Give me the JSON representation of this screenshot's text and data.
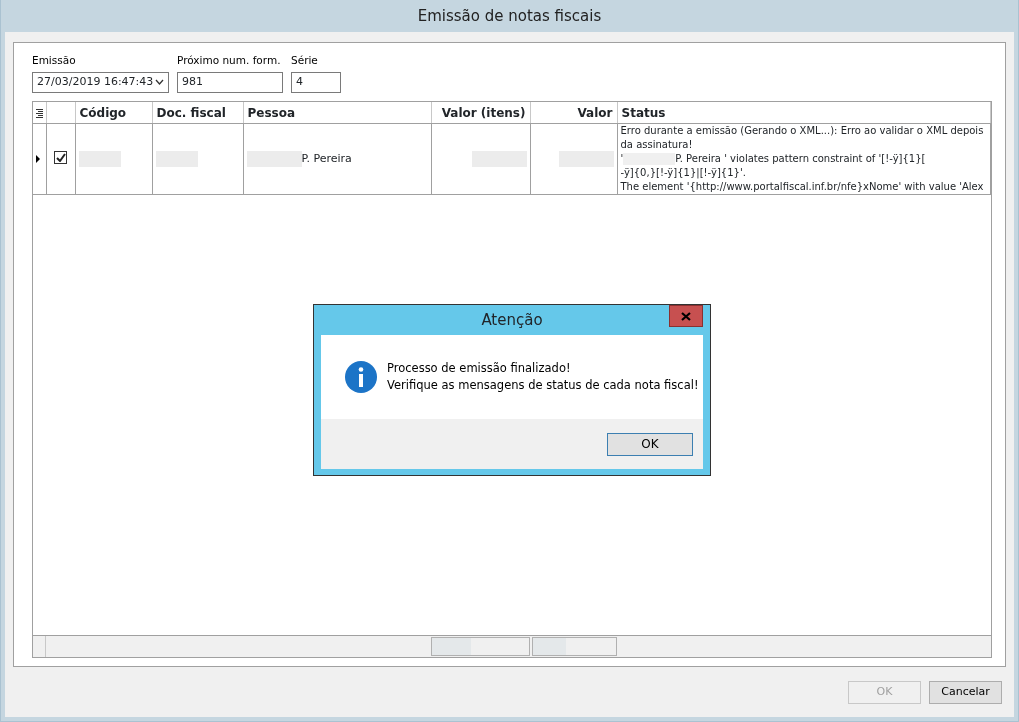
{
  "window": {
    "title": "Emissão de notas fiscais"
  },
  "fields": [
    {
      "label": "Emissão",
      "value": "27/03/2019 16:47:43",
      "kind": "dropdown"
    },
    {
      "label": "Próximo num. form.",
      "value": "981",
      "kind": "text"
    },
    {
      "label": "Série",
      "value": "4",
      "kind": "text"
    }
  ],
  "table": {
    "columns": [
      "Código",
      "Doc. fiscal",
      "Pessoa",
      "Valor (itens)",
      "Valor",
      "Status"
    ],
    "rows": [
      {
        "selected": true,
        "checked": true,
        "cells": [
          {
            "redacted": true
          },
          {
            "redacted": true
          },
          {
            "redacted": true,
            "text": "P. Pereira"
          },
          {
            "redacted": true
          },
          {
            "redacted": true
          }
        ],
        "status": [
          {
            "text": "Erro durante a emissão (Gerando o XML...): Erro ao validar o XML depois da assinatura!",
            "redacted": false
          },
          {
            "lead": "'",
            "text": "P. Pereira ' violates pattern constraint of '[!-ÿ]{1}[",
            "redacted": true
          },
          {
            "text": "-ÿ]{0,}[!-ÿ]{1}|[!-ÿ]{1}'.",
            "redacted": false
          },
          {
            "text": "The element '{http://www.portalfiscal.inf.br/nfe}xNome' with value 'Alex",
            "redacted": false
          }
        ]
      }
    ]
  },
  "dialog": {
    "title": "Atenção",
    "message": [
      "Processo de emissão finalizado!",
      "Verifique as mensagens de status de cada nota fiscal!"
    ],
    "button": "OK"
  },
  "buttons": [
    {
      "label": "OK",
      "disabled": true
    },
    {
      "label": "Cancelar",
      "disabled": false
    }
  ]
}
